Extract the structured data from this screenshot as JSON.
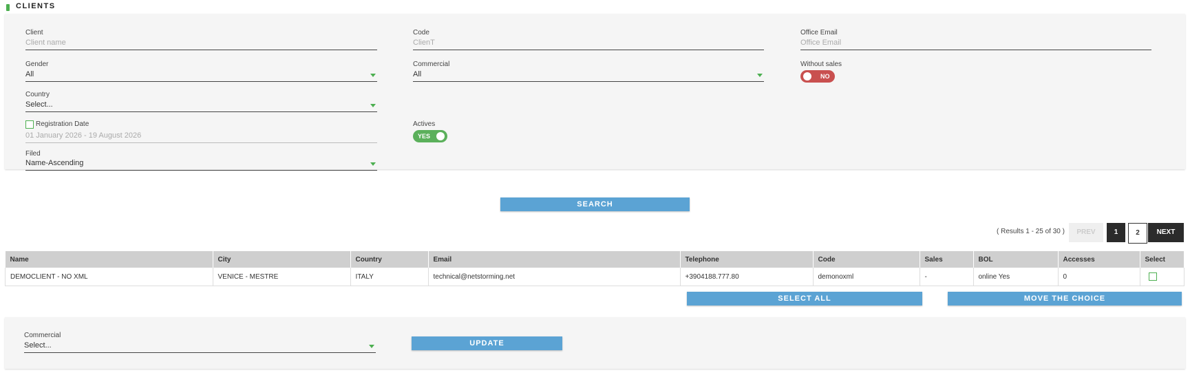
{
  "header": {
    "title": "CLIENTS"
  },
  "filters": {
    "client": {
      "label": "Client",
      "placeholder": "Client name"
    },
    "code": {
      "label": "Code",
      "placeholder": "ClienT"
    },
    "office_email": {
      "label": "Office Email",
      "placeholder": "Office Email"
    },
    "gender": {
      "label": "Gender",
      "value": "All"
    },
    "commercial": {
      "label": "Commercial",
      "value": "All"
    },
    "without_sales": {
      "label": "Without sales",
      "state": "NO"
    },
    "country": {
      "label": "Country",
      "value": "Select..."
    },
    "registration_date": {
      "label": "Registration Date",
      "value": "01 January 2026 - 19 August 2026",
      "checked": false
    },
    "actives": {
      "label": "Actives",
      "state": "YES"
    },
    "filed": {
      "label": "Filed",
      "value": "Name-Ascending"
    }
  },
  "search_button": "SEARCH",
  "pagination": {
    "results_text": "( Results 1 - 25 of 30 )",
    "prev": "PREV",
    "pages": [
      "1",
      "2"
    ],
    "next": "NEXT",
    "current": "1"
  },
  "table": {
    "headers": [
      "Name",
      "City",
      "Country",
      "Email",
      "Telephone",
      "Code",
      "Sales",
      "BOL",
      "Accesses",
      "Select"
    ],
    "rows": [
      [
        "DEMOCLIENT - NO XML",
        "VENICE - MESTRE",
        "ITALY",
        "technical@netstorming.net",
        "+3904188.777.80",
        "demonoxml",
        "-",
        "online Yes",
        "0",
        ""
      ]
    ]
  },
  "actions": {
    "select_all": "SELECT ALL",
    "move_choice": "MOVE THE CHOICE"
  },
  "bulk": {
    "commercial": {
      "label": "Commercial",
      "value": "Select..."
    },
    "update_button": "UPDATE"
  },
  "colors": {
    "accent": "#4caf50",
    "button": "#5ba3d4",
    "toggle_no": "#c9504f",
    "toggle_yes": "#5bb05b",
    "pager_dark": "#2b2b2b"
  }
}
